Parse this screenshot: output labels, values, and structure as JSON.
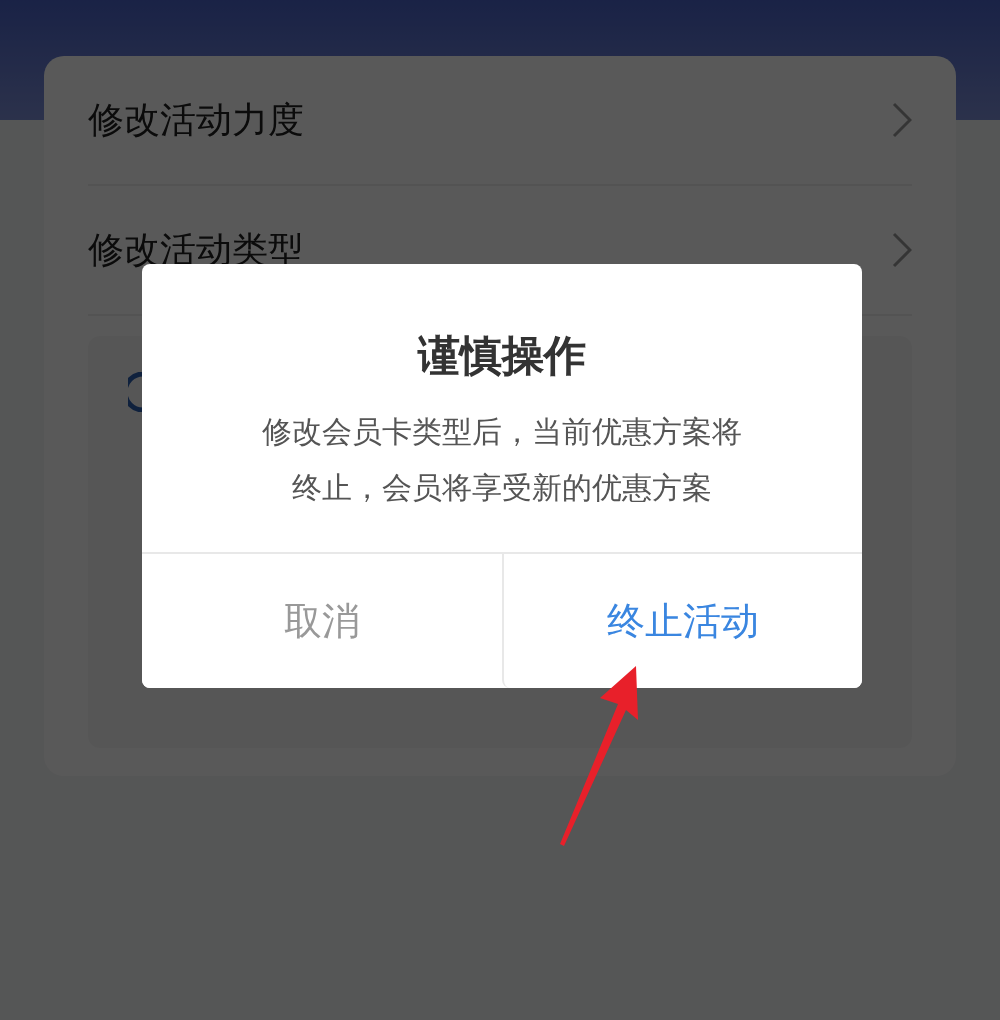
{
  "menu": {
    "items": [
      {
        "label": "修改活动力度"
      },
      {
        "label": "修改活动类型"
      }
    ]
  },
  "dialog": {
    "title": "谨慎操作",
    "message": "修改会员卡类型后，当前优惠方案将终止，会员将享受新的优惠方案",
    "buttons": [
      {
        "label": "取消",
        "kind": "cancel"
      },
      {
        "label": "终止活动",
        "kind": "confirm"
      }
    ]
  }
}
